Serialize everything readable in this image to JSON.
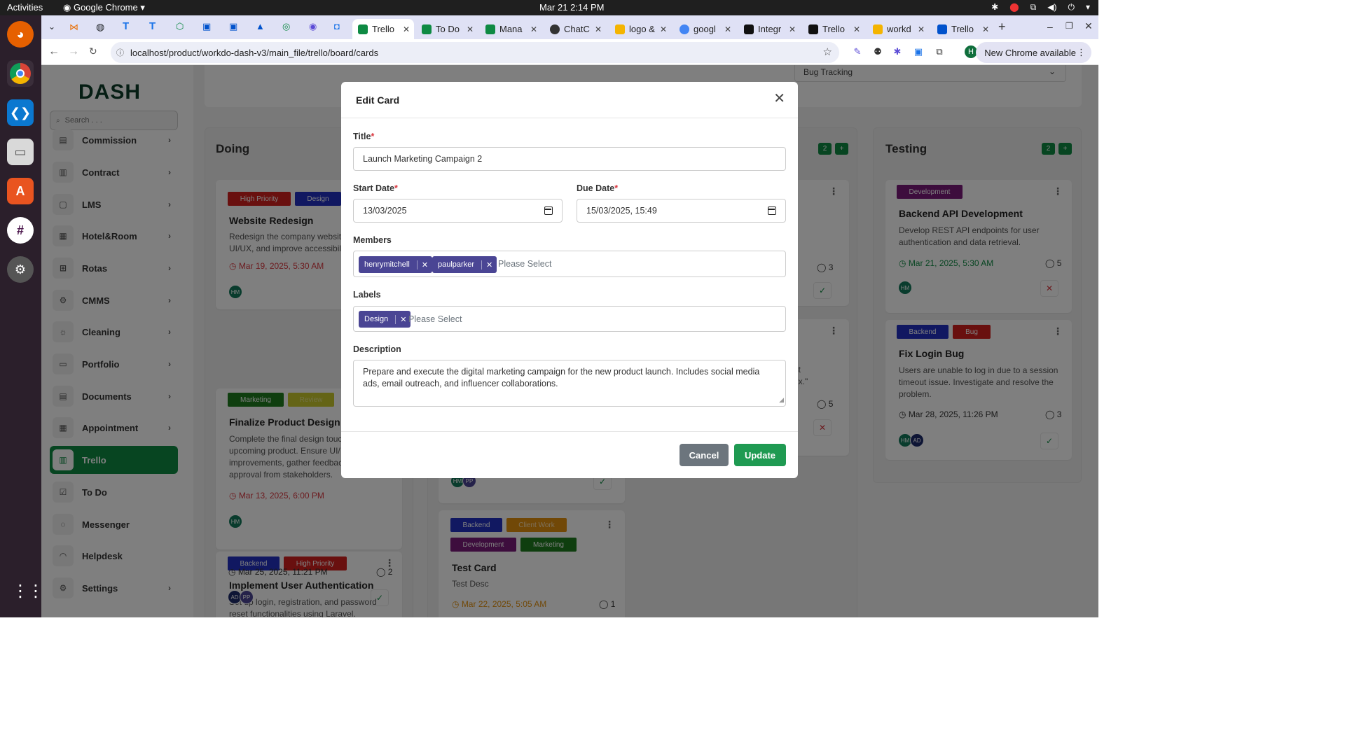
{
  "system": {
    "activities": "Activities",
    "browser_menu": "Google Chrome",
    "clock": "Mar 21  2:14 PM"
  },
  "browser": {
    "tabs": [
      {
        "label": "Trello",
        "color": "#0e8a43"
      },
      {
        "label": "To Do",
        "color": "#0e8a43"
      },
      {
        "label": "Mana",
        "color": "#0e8a43"
      },
      {
        "label": "ChatC",
        "color": "#333333"
      },
      {
        "label": "logo &",
        "color": "#1a73e8"
      },
      {
        "label": "googl",
        "color": "#1a73e8"
      },
      {
        "label": "Integr",
        "color": "#111111"
      },
      {
        "label": "Trello",
        "color": "#111111"
      },
      {
        "label": "workd",
        "color": "#1a73e8"
      },
      {
        "label": "Trello",
        "color": "#0052cc"
      }
    ],
    "url": "localhost/product/workdo-dash-v3/main_file/trello/board/cards",
    "new_chrome": "New Chrome available",
    "profile_initial": "H"
  },
  "sidebar": {
    "logo": "DASH",
    "search_placeholder": "Search . . .",
    "items": [
      {
        "label": "Commission",
        "icon": "commission-icon",
        "glyph": "▤"
      },
      {
        "label": "Contract",
        "icon": "contract-icon",
        "glyph": "▥"
      },
      {
        "label": "LMS",
        "icon": "book-icon",
        "glyph": "▢"
      },
      {
        "label": "Hotel&Room",
        "icon": "hotel-icon",
        "glyph": "▦"
      },
      {
        "label": "Rotas",
        "icon": "grid-icon",
        "glyph": "⊞"
      },
      {
        "label": "CMMS",
        "icon": "cmms-icon",
        "glyph": "⚙"
      },
      {
        "label": "Cleaning",
        "icon": "sun-icon",
        "glyph": "☼"
      },
      {
        "label": "Portfolio",
        "icon": "briefcase-icon",
        "glyph": "▭"
      },
      {
        "label": "Documents",
        "icon": "document-icon",
        "glyph": "▤"
      },
      {
        "label": "Appointment",
        "icon": "calendar-icon",
        "glyph": "▦"
      },
      {
        "label": "Trello",
        "icon": "trello-icon",
        "glyph": "▥"
      },
      {
        "label": "To Do",
        "icon": "checkbox-icon",
        "glyph": "☑"
      },
      {
        "label": "Messenger",
        "icon": "chat-icon",
        "glyph": "◌"
      },
      {
        "label": "Helpdesk",
        "icon": "headset-icon",
        "glyph": "◠"
      },
      {
        "label": "Settings",
        "icon": "gear-icon",
        "glyph": "⚙"
      }
    ]
  },
  "board": {
    "project_select": "Bug Tracking",
    "columns": {
      "doing": {
        "title": "Doing"
      },
      "review": {
        "count": "2"
      },
      "testing": {
        "title": "Testing",
        "count": "2"
      }
    },
    "cards": {
      "website_redesign": {
        "labels": [
          "High Priority",
          "Design"
        ],
        "title": "Website Redesign",
        "desc": "Redesign the company website UI/UX, and improve accessibili",
        "date": "Mar 19, 2025, 5:30 AM",
        "members": [
          "HM"
        ]
      },
      "finalize_design": {
        "labels": [
          "Marketing",
          "Review"
        ],
        "title": "Finalize Product Design",
        "desc": "Complete the final design touc upcoming product. Ensure UI/ improvements, gather feedbac approval from stakeholders.",
        "date": "Mar 13, 2025, 6:00 PM",
        "members": [
          "HM"
        ]
      },
      "user_auth": {
        "labels": [
          "Backend",
          "High Priority"
        ],
        "title": "Implement User Authentication",
        "desc": "Set up login, registration, and password reset functionalities using Laravel.",
        "date": "Mar 25, 2025, 11:21 PM",
        "comments": "2",
        "members": [
          "AD",
          "PP"
        ]
      },
      "review_card_1": {
        "comments": "3"
      },
      "review_card_2": {
        "desc_a": "atest",
        "desc_b": "hotfix.\"",
        "comments": "5"
      },
      "review_card_3": {
        "members": [
          "HM",
          "PP"
        ]
      },
      "test_card": {
        "labels": [
          "Backend",
          "Client Work",
          "Development",
          "Marketing"
        ],
        "title": "Test Card",
        "desc": "Test Desc",
        "date": "Mar 22, 2025, 5:05 AM",
        "comments": "1"
      },
      "backend_api": {
        "labels": [
          "Development"
        ],
        "title": "Backend API Development",
        "desc": "Develop REST API endpoints for user authentication and data retrieval.",
        "date": "Mar 21, 2025, 5:30 AM",
        "comments": "5",
        "members": [
          "HM"
        ]
      },
      "fix_login": {
        "labels": [
          "Backend",
          "Bug"
        ],
        "title": "Fix Login Bug",
        "desc": "Users are unable to log in due to a session timeout issue. Investigate and resolve the problem.",
        "date": "Mar 28, 2025, 11:26 PM",
        "comments": "3",
        "members": [
          "HM",
          "AD"
        ]
      }
    }
  },
  "modal": {
    "title": "Edit Card",
    "title_label": "Title",
    "title_value": "Launch Marketing Campaign 2",
    "start_label": "Start Date",
    "start_value": "13/03/2025",
    "due_label": "Due Date",
    "due_value": "15/03/2025, 15:49",
    "members_label": "Members",
    "members": [
      "henrymitchell",
      "paulparker"
    ],
    "members_placeholder": "Please Select",
    "labels_label": "Labels",
    "labels": [
      "Design"
    ],
    "labels_placeholder": "Please Select",
    "description_label": "Description",
    "description_value": "Prepare and execute the digital marketing campaign for the new product launch. Includes social media ads, email outreach, and influencer collaborations.",
    "cancel": "Cancel",
    "update": "Update"
  }
}
